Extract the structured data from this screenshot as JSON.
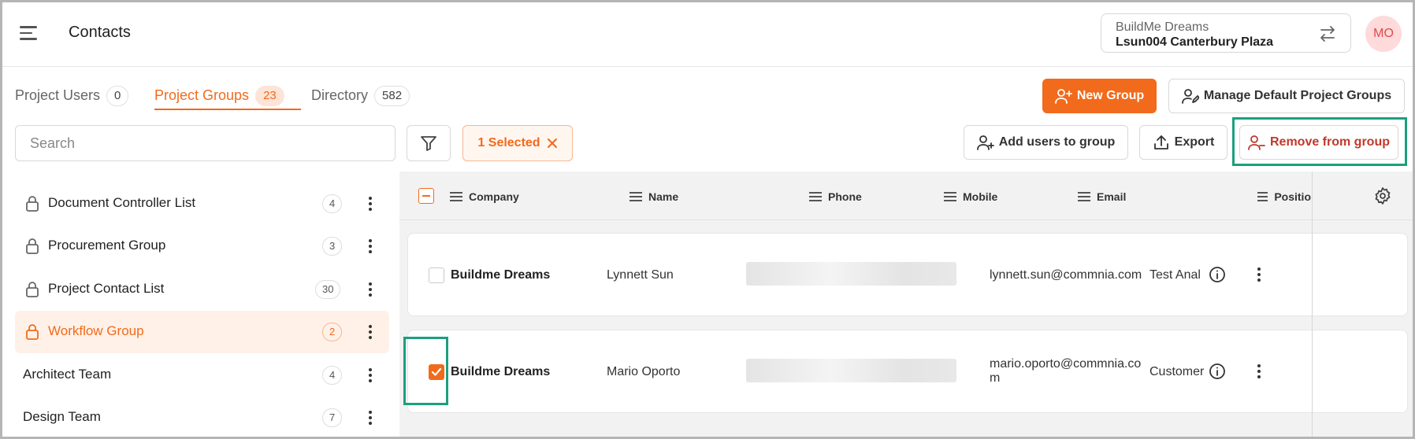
{
  "header": {
    "title": "Contacts",
    "project_switcher": {
      "company": "BuildMe Dreams",
      "project": "Lsun004 Canterbury Plaza"
    },
    "avatar_initials": "MO"
  },
  "tabs": [
    {
      "label": "Project Users",
      "count": "0"
    },
    {
      "label": "Project Groups",
      "count": "23",
      "active": true
    },
    {
      "label": "Directory",
      "count": "582"
    }
  ],
  "actions": {
    "new_group": "New Group",
    "manage_default": "Manage Default Project Groups",
    "add_users": "Add users to group",
    "export": "Export",
    "remove_from_group": "Remove from group"
  },
  "search": {
    "placeholder": "Search",
    "value": ""
  },
  "selection_chip": "1 Selected",
  "groups": [
    {
      "label": "Document Controller List",
      "count": "4",
      "locked": true
    },
    {
      "label": "Procurement Group",
      "count": "3",
      "locked": true
    },
    {
      "label": "Project Contact List",
      "count": "30",
      "locked": true
    },
    {
      "label": "Workflow Group",
      "count": "2",
      "locked": true,
      "active": true
    },
    {
      "label": "Architect Team",
      "count": "4",
      "locked": false
    },
    {
      "label": "Design Team",
      "count": "7",
      "locked": false
    }
  ],
  "table": {
    "columns": [
      "Company",
      "Name",
      "Phone",
      "Mobile",
      "Email",
      "Positio"
    ],
    "rows": [
      {
        "company": "Buildme Dreams",
        "name": "Lynnett Sun",
        "email": "lynnett.sun@commnia.com",
        "position": "Test Anal",
        "checked": false
      },
      {
        "company": "Buildme Dreams",
        "name": "Mario Oporto",
        "email_line1": "mario.oporto@commnia.co",
        "email_line2": "m",
        "position": "Customer",
        "checked": true
      }
    ]
  },
  "colors": {
    "accent": "#f26a1b",
    "danger": "#c0392b",
    "highlight": "#1aa07f"
  }
}
